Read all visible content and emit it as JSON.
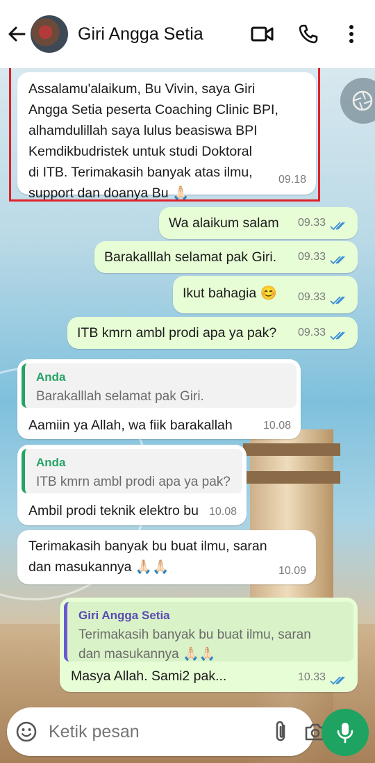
{
  "header": {
    "contact_name": "Giri Angga Setia"
  },
  "messages": [
    {
      "dir": "in",
      "text_lines": [
        "Assalamu'alaikum, Bu Vivin, saya Giri",
        "Angga Setia peserta Coaching Clinic BPI,",
        "alhamdulillah saya lulus beasiswa BPI",
        "Kemdikbudristek untuk studi Doktoral",
        "di ITB. Terimakasih banyak atas ilmu,",
        "support dan doanya Bu 🙏🏻"
      ],
      "time": "09.18"
    },
    {
      "dir": "out",
      "text": "Wa alaikum salam",
      "time": "09.33"
    },
    {
      "dir": "out",
      "text": "Barakalllah selamat pak Giri.",
      "time": "09.33"
    },
    {
      "dir": "out",
      "text": "Ikut bahagia 😊",
      "time": "09.33"
    },
    {
      "dir": "out",
      "text": "ITB kmrn ambl prodi apa ya pak?",
      "time": "09.33"
    },
    {
      "dir": "in",
      "quote_name": "Anda",
      "quote_text": "Barakalllah selamat pak Giri.",
      "text": "Aamiin ya Allah, wa fiik barakallah",
      "time": "10.08"
    },
    {
      "dir": "in",
      "quote_name": "Anda",
      "quote_text": "ITB kmrn ambl prodi apa ya pak?",
      "text": "Ambil prodi teknik elektro bu",
      "time": "10.08"
    },
    {
      "dir": "in",
      "text_lines": [
        "Terimakasih banyak bu buat ilmu, saran",
        "dan masukannya 🙏🏻🙏🏻"
      ],
      "time": "10.09"
    },
    {
      "dir": "out",
      "quote_name": "Giri Angga Setia",
      "quote_lines": [
        "Terimakasih banyak bu buat ilmu, saran",
        "dan masukannya 🙏🏻🙏🏻"
      ],
      "text": "Masya Allah. Sami2 pak...",
      "time": "10.33"
    }
  ],
  "composer": {
    "placeholder": "Ketik pesan"
  },
  "colors": {
    "accent_green": "#1ea362",
    "outgoing_bubble": "#e7fdd6",
    "read_ticks": "#3b8fd9",
    "highlight_border": "#e0202a"
  }
}
